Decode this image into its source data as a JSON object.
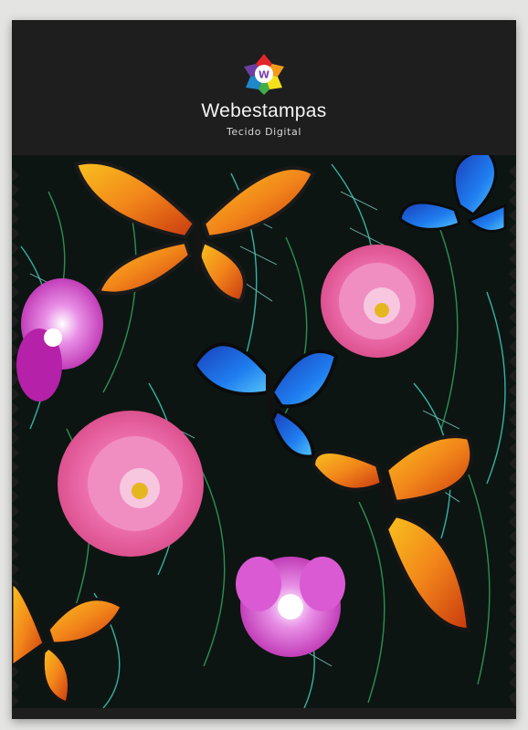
{
  "brand": {
    "name": "Webestampas",
    "tagline": "Tecido Digital"
  },
  "colors": {
    "card": "#1e1e1e",
    "background": "#e4e4e2",
    "leaf_teal": "#39c4b2",
    "leaf_green": "#2f9d5c",
    "monarch_orange": "#f28a1a",
    "morpho_blue": "#1f6fe6",
    "peony_pink": "#ef77b6",
    "orchid_magenta": "#d23ec6"
  },
  "icons": {
    "logo": "webestampas-logo-icon"
  }
}
